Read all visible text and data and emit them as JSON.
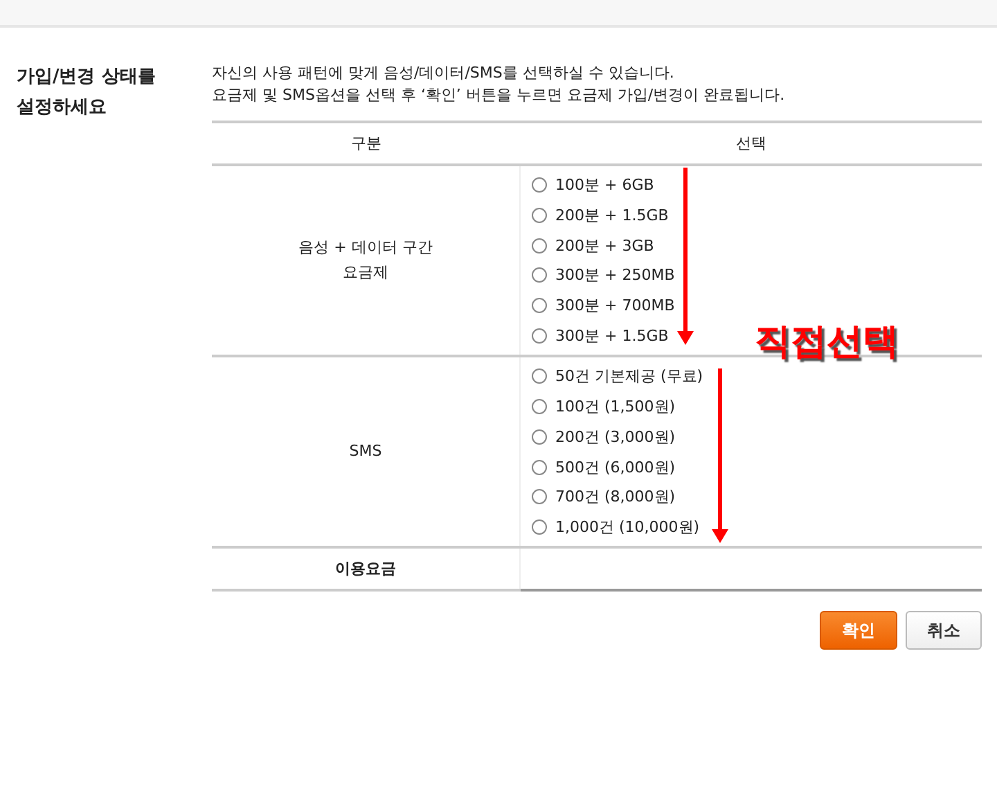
{
  "heading": "가입/변경 상태를\n설정하세요",
  "intro": [
    "자신의 사용 패턴에 맞게 음성/데이터/SMS를 선택하실 수 있습니다.",
    "요금제 및 SMS옵션을 선택 후 ‘확인’ 버튼을 누르면 요금제 가입/변경이 완료됩니다."
  ],
  "table": {
    "columns": [
      "구분",
      "선택"
    ],
    "rows": [
      {
        "label": "음성 + 데이터 구간\n요금제",
        "options": [
          {
            "label": "100분 + 6GB",
            "selected": false
          },
          {
            "label": "200분 + 1.5GB",
            "selected": false
          },
          {
            "label": "200분 + 3GB",
            "selected": false
          },
          {
            "label": "300분 + 250MB",
            "selected": false
          },
          {
            "label": "300분 + 700MB",
            "selected": false
          },
          {
            "label": "300분 + 1.5GB",
            "selected": false
          }
        ]
      },
      {
        "label": "SMS",
        "options": [
          {
            "label": "50건 기본제공 (무료)",
            "selected": false
          },
          {
            "label": "100건 (1,500원)",
            "selected": false
          },
          {
            "label": "200건 (3,000원)",
            "selected": false
          },
          {
            "label": "500건 (6,000원)",
            "selected": false
          },
          {
            "label": "700건 (8,000원)",
            "selected": false
          },
          {
            "label": "1,000건 (10,000원)",
            "selected": false
          }
        ]
      }
    ],
    "fee_label": "이용요금"
  },
  "annotation": "직접선택",
  "buttons": [
    {
      "label": "확인",
      "kind": "primary"
    },
    {
      "label": "취소",
      "kind": "secondary"
    }
  ]
}
